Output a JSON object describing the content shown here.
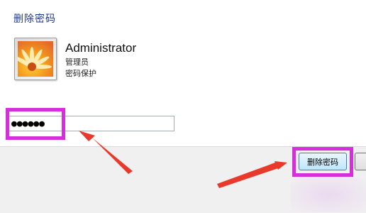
{
  "dialog": {
    "title": "删除密码"
  },
  "user": {
    "name": "Administrator",
    "role": "管理员",
    "status": "密码保护"
  },
  "password_field": {
    "value": "●●●●●●"
  },
  "buttons": {
    "delete_label": "删除密码",
    "cancel_label": ""
  },
  "annotation_color": "#d62edb",
  "arrow_color": "#e8392b"
}
